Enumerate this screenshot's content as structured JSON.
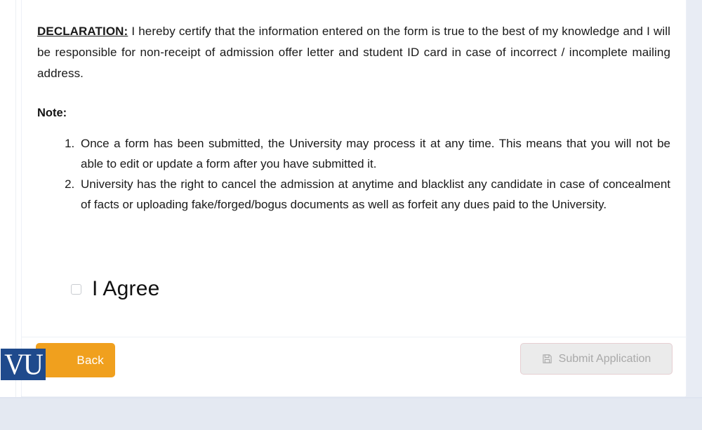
{
  "declaration": {
    "lead": "DECLARATION:",
    "body": " I hereby certify that the information entered on the form is true to the best of my knowledge and I will be responsible for non-receipt of admission offer letter and student ID card in case of incorrect / incomplete mailing address."
  },
  "note": {
    "heading": "Note:",
    "items": [
      "Once a form has been submitted, the University may process it at any time. This means that you will not be able to edit or update a form after you have submitted it.",
      "University has the right to cancel the admission at anytime and blacklist any candidate in case of concealment of facts or uploading fake/forged/bogus documents as well as forfeit any dues paid to the University."
    ]
  },
  "agree": {
    "label": "I Agree",
    "checked": false
  },
  "footer": {
    "back_label": "Back",
    "submit_label": "Submit Application",
    "submit_icon": "save-icon",
    "logo_text": "VU"
  },
  "colors": {
    "accent_orange": "#f0a01e",
    "logo_navy": "#1f4a8c",
    "page_background": "#e4e9f2",
    "disabled_gray": "#ebebeb"
  }
}
